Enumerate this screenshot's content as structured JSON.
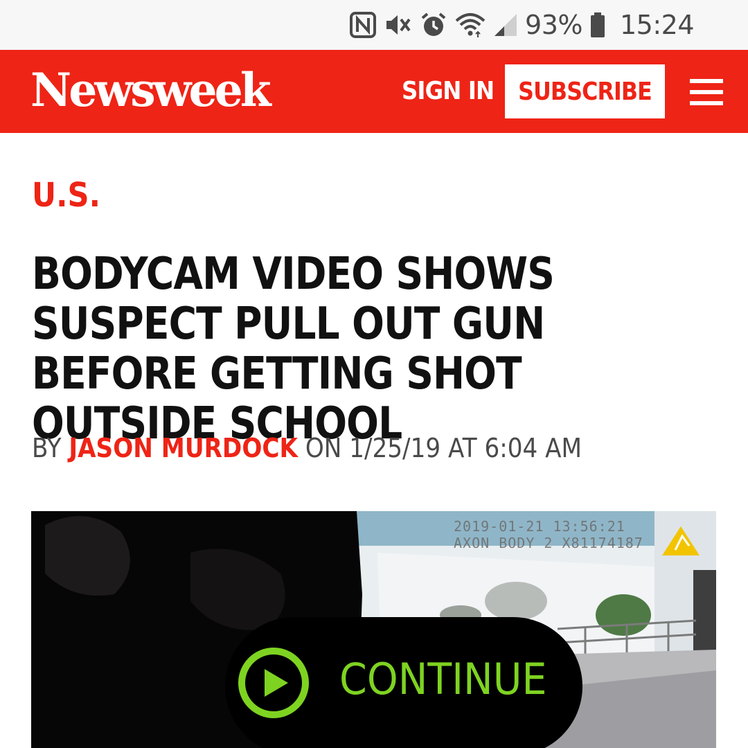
{
  "status_bar": {
    "battery": "93%",
    "time": "15:24",
    "icons": [
      "nfc-icon",
      "vibrate-icon",
      "alarm-icon",
      "wifi-icon",
      "signal-icon",
      "battery-icon"
    ]
  },
  "header": {
    "logo": "Newsweek",
    "sign_in": "SIGN IN",
    "subscribe": "SUBSCRIBE",
    "menu_icon": "hamburger-menu-icon"
  },
  "article": {
    "section": "U.S.",
    "headline": "BODYCAM VIDEO SHOWS SUSPECT PULL OUT GUN BEFORE GETTING SHOT OUTSIDE SCHOOL",
    "byline": {
      "prefix": "BY",
      "author": "JASON MURDOCK",
      "date_text": "ON 1/25/19 AT 6:04 AM"
    }
  },
  "video": {
    "overlay_line1": "2019-01-21 13:56:21",
    "overlay_line2": "AXON BODY 2 X81174187",
    "continue_label": "CONTINUE",
    "play_icon": "play-circle-icon"
  },
  "colors": {
    "brand_red": "#ee2416",
    "continue_green": "#7ed321",
    "text_dark": "#111111",
    "text_gray": "#4a4a4a"
  }
}
